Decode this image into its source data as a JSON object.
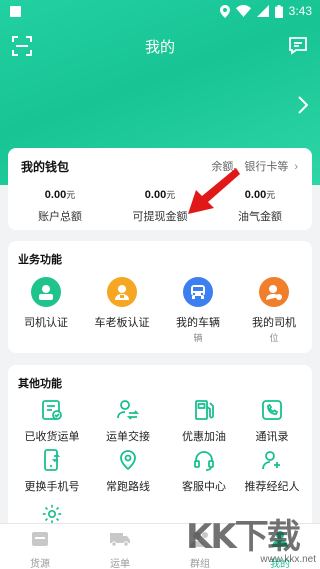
{
  "status_bar": {
    "time": "3:43"
  },
  "header": {
    "title": "我的"
  },
  "wallet": {
    "title": "我的钱包",
    "hint": "余额、银行卡等",
    "items": [
      {
        "value": "0.00",
        "unit": "元",
        "label": "账户总额"
      },
      {
        "value": "0.00",
        "unit": "元",
        "label": "可提现金额"
      },
      {
        "value": "0.00",
        "unit": "元",
        "label": "油气金额"
      }
    ]
  },
  "business": {
    "title": "业务功能",
    "items": [
      {
        "label": "司机认证",
        "sub": "",
        "icon": "driver-id-icon",
        "color": "#1fc48c"
      },
      {
        "label": "车老板认证",
        "sub": "",
        "icon": "owner-id-icon",
        "color": "#f5a623"
      },
      {
        "label": "我的车辆",
        "sub": "辆",
        "icon": "vehicle-icon",
        "color": "#3d7ff0"
      },
      {
        "label": "我的司机",
        "sub": "位",
        "icon": "my-driver-icon",
        "color": "#f07e2a"
      }
    ]
  },
  "other": {
    "title": "其他功能",
    "items": [
      {
        "label": "已收货运单",
        "icon": "received-order-icon"
      },
      {
        "label": "运单交接",
        "icon": "handover-icon"
      },
      {
        "label": "优惠加油",
        "icon": "fuel-icon"
      },
      {
        "label": "通讯录",
        "icon": "contacts-icon"
      },
      {
        "label": "更换手机号",
        "icon": "change-phone-icon"
      },
      {
        "label": "常跑路线",
        "icon": "route-icon"
      },
      {
        "label": "客服中心",
        "icon": "headset-icon"
      },
      {
        "label": "推荐经纪人",
        "icon": "recommend-icon"
      },
      {
        "label": "",
        "icon": "settings-icon"
      }
    ]
  },
  "tabbar": {
    "items": [
      {
        "label": "货源",
        "icon": "cargo-icon"
      },
      {
        "label": "运单",
        "icon": "truck-icon"
      },
      {
        "label": "群组",
        "icon": "group-icon"
      },
      {
        "label": "我的",
        "icon": "profile-icon",
        "active": true
      }
    ]
  },
  "watermark": {
    "brand": "KK下载",
    "url": "www.kkx.net"
  },
  "colors": {
    "accent": "#19c08f",
    "header": "#1ec89a",
    "annotation_arrow": "#e01818"
  }
}
